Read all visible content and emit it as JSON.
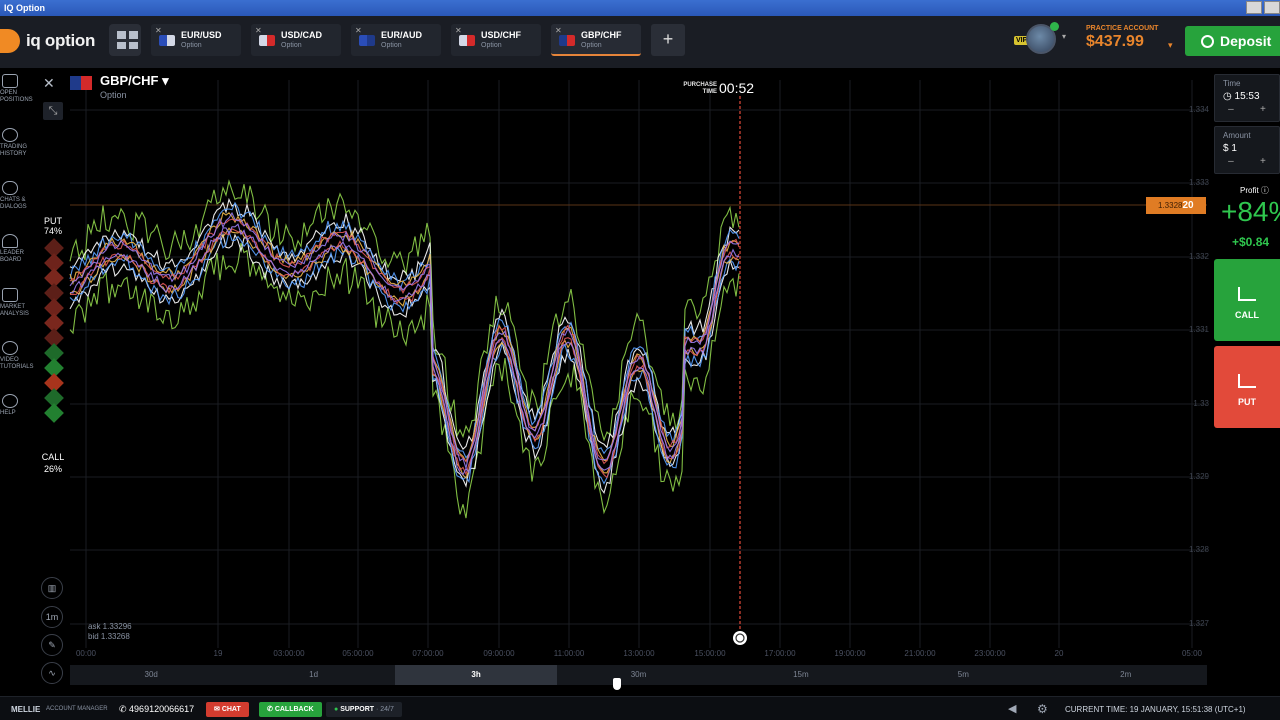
{
  "window": {
    "title": "IQ Option"
  },
  "header": {
    "logo_text": "iq option",
    "tabs": [
      {
        "name": "EUR/USD",
        "type": "Option",
        "active": false
      },
      {
        "name": "USD/CAD",
        "type": "Option",
        "active": false
      },
      {
        "name": "EUR/AUD",
        "type": "Option",
        "active": false
      },
      {
        "name": "USD/CHF",
        "type": "Option",
        "active": false
      },
      {
        "name": "GBP/CHF",
        "type": "Option",
        "active": true
      }
    ],
    "add_tab": "+",
    "vip_badge": "VIP",
    "account_label": "PRACTICE ACCOUNT",
    "balance": "$437.99",
    "deposit_label": "Deposit"
  },
  "nav": [
    {
      "label": "OPEN\nPOSITIONS",
      "icon": "positions-icon"
    },
    {
      "label": "TRADING\nHISTORY",
      "icon": "history-icon"
    },
    {
      "label": "CHATS &\nDIALOGS",
      "icon": "chat-icon"
    },
    {
      "label": "LEADER\nBOARD",
      "icon": "leaderboard-icon"
    },
    {
      "label": "MARKET\nANALYSIS",
      "icon": "market-icon"
    },
    {
      "label": "VIDEO\nTUTORIALS",
      "icon": "video-icon"
    },
    {
      "label": "HELP",
      "icon": "help-icon"
    }
  ],
  "asset": {
    "name": "GBP/CHF",
    "type": "Option"
  },
  "purchase": {
    "label": "PURCHASE TIME",
    "time": "00:52"
  },
  "sentiment": {
    "put_label": "PUT",
    "put_pct": "74%",
    "call_label": "CALL",
    "call_pct": "26%"
  },
  "current_price": {
    "prefix": "1.3328",
    "suffix": "20"
  },
  "y_ticks": [
    "1.334",
    "1.333",
    "1.332",
    "1.331",
    "1.33",
    "1.329",
    "1.328",
    "1.327"
  ],
  "x_ticks": [
    "00:00",
    "19",
    "03:00:00",
    "05:00:00",
    "07:00:00",
    "09:00:00",
    "11:00:00",
    "13:00:00",
    "15:00:00",
    "17:00:00",
    "19:00:00",
    "21:00:00",
    "23:00:00",
    "20",
    "05:00"
  ],
  "ask": "ask 1.33296",
  "bid": "bid 1.33268",
  "tools": {
    "chart_type": "1m"
  },
  "timeframes": [
    {
      "label": "30d",
      "active": false
    },
    {
      "label": "1d",
      "active": false
    },
    {
      "label": "3h",
      "active": true
    },
    {
      "label": "30m",
      "active": false
    },
    {
      "label": "15m",
      "active": false
    },
    {
      "label": "5m",
      "active": false
    },
    {
      "label": "2m",
      "active": false
    }
  ],
  "right_panel": {
    "time_label": "Time",
    "time_value": "15:53",
    "amount_label": "Amount",
    "amount_value": "$ 1",
    "profit_label": "Profit",
    "profit_pct": "+84%",
    "profit_amount": "+$0.84",
    "call_label": "CALL",
    "put_label": "PUT"
  },
  "bottom": {
    "user_name": "MELLIE",
    "manager_label": "ACCOUNT MANAGER",
    "phone": "4969120066617",
    "chat_label": "CHAT",
    "callback_label": "CALLBACK",
    "support_label": "SUPPORT",
    "support_hours": "· 24/7",
    "current_time": "CURRENT TIME: 19 JANUARY, 15:51:38 (UTC+1)"
  },
  "colors": {
    "accent": "#e8852c",
    "call": "#27a33c",
    "put": "#e24a3a"
  }
}
